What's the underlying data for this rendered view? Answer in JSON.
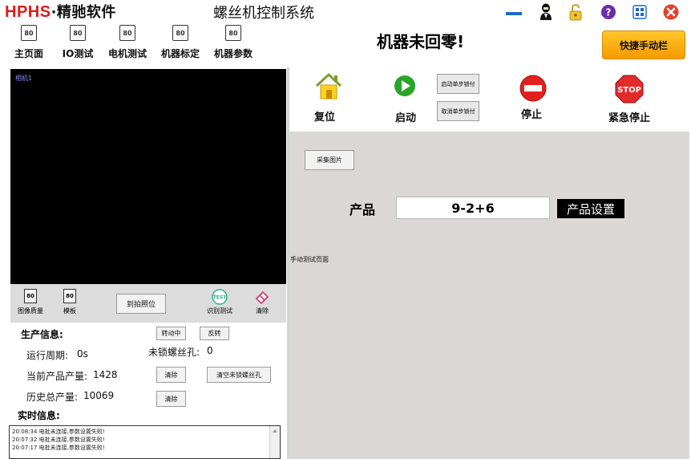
{
  "header": {
    "logo_brand": "HPHS",
    "logo_dot": "·",
    "logo_name": "精驰软件",
    "app_title": "螺丝机控制系统"
  },
  "nav": {
    "icon_text": "80",
    "items": [
      {
        "label": "主页面"
      },
      {
        "label": "IO测试"
      },
      {
        "label": "电机测试"
      },
      {
        "label": "机器标定"
      },
      {
        "label": "机器参数"
      }
    ]
  },
  "status": {
    "machine_status": "机器未回零!",
    "quick_manual_label": "快捷手动栏"
  },
  "camera": {
    "label": "相机1",
    "toolbar": {
      "image_quality": "图像质量",
      "template": "模板",
      "goto_photo": "到拍照位",
      "test_icon_text": "TEST",
      "recognize_test": "识别测试",
      "clear": "清除"
    }
  },
  "production": {
    "heading": "生产信息:",
    "rotating_btn": "转动中",
    "reverse_btn": "反转",
    "cycle_label": "运行周期:",
    "cycle_value": "0s",
    "unlocked_holes_label": "未锁螺丝孔:",
    "unlocked_holes_value": "0",
    "current_output_label": "当前产品产量:",
    "current_output_value": "1428",
    "clear_btn": "清除",
    "clear_unlocked_btn": "清空未锁螺丝孔",
    "history_output_label": "历史总产量:",
    "history_output_value": "10069",
    "clear_btn_2": "清除",
    "realtime_heading": "实时信息:"
  },
  "log": [
    "20:08:34 电批未连接,参数设置失败!",
    "20:07:32 电批未连接,参数设置失败!",
    "20:07:17 电批未连接,参数设置失败!"
  ],
  "controls": {
    "reset": "复位",
    "start": "启动",
    "enable_step_lock": "启动单步锁付",
    "cancel_step_lock": "取消单步锁付",
    "stop": "停止",
    "stop_icon_text": "STOP",
    "emergency_stop": "紧急停止"
  },
  "main": {
    "capture_image": "采集图片",
    "product_label": "产品",
    "product_value": "9-2+6",
    "product_settings": "产品设置",
    "manual_test_page": "手动测试页面"
  },
  "colors": {
    "brand_red": "#e01b1b",
    "accent_blue": "#1d67c9",
    "quick_btn_yellow": "#f5a800",
    "right_panel_bg": "#dcd7d7"
  }
}
